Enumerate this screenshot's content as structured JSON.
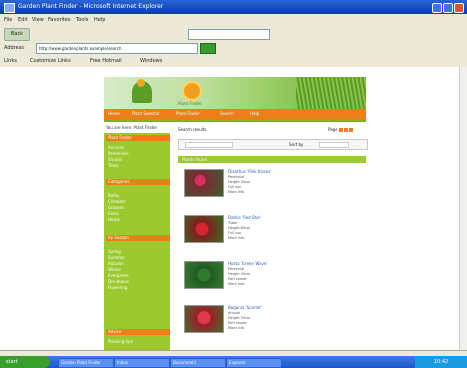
{
  "window": {
    "title": "Garden Plant Finder - Microsoft Internet Explorer"
  },
  "menu": [
    "File",
    "Edit",
    "View",
    "Favorites",
    "Tools",
    "Help"
  ],
  "nav": {
    "back_label": "Back"
  },
  "address": {
    "label": "Address",
    "value": "http://www.gardenplants.example/search"
  },
  "links": {
    "items": [
      "Links",
      "Customize Links",
      "Free Hotmail",
      "Windows"
    ]
  },
  "site": {
    "logo_text": "Plant Finder",
    "nav_items": [
      "Home",
      "Plant Selector",
      "Plant Finder",
      "Search",
      "Help"
    ],
    "breadcrumb": "You are here: Plant Finder",
    "sidebar_sections": [
      {
        "heading": "Plant Finder",
        "items": [
          "Annuals",
          "Perennials",
          "Shrubs",
          "Trees"
        ]
      },
      {
        "heading": "Categories",
        "items": [
          "Bulbs",
          "Climbers",
          "Grasses",
          "Ferns",
          "Herbs"
        ]
      },
      {
        "heading": "By Season",
        "items": [
          "Spring",
          "Summer",
          "Autumn",
          "Winter",
          "Evergreen",
          "Deciduous",
          "Flowering"
        ]
      },
      {
        "heading": "Advice",
        "items": [
          "Planting tips"
        ]
      }
    ],
    "main_title": "Search results",
    "pager": "Page",
    "sort_label": "Sort by",
    "results_header": "Plants found",
    "products": [
      {
        "title": "Dianthus 'Pink Kisses'",
        "lines": [
          "Perennial",
          "Height 30cm",
          "Full sun",
          "More info"
        ]
      },
      {
        "title": "Dahlia 'Red Star'",
        "lines": [
          "Tuber",
          "Height 60cm",
          "Full sun",
          "More info"
        ]
      },
      {
        "title": "Hosta 'Green Wave'",
        "lines": [
          "Perennial",
          "Height 40cm",
          "Part shade",
          "More info"
        ]
      },
      {
        "title": "Begonia 'Scarlet'",
        "lines": [
          "Annual",
          "Height 25cm",
          "Part shade",
          "More info"
        ]
      }
    ]
  },
  "taskbar": {
    "start_label": "start",
    "tasks": [
      "Garden Plant Finder",
      "Inbox",
      "Document1",
      "Explorer"
    ],
    "clock": "10:42"
  }
}
